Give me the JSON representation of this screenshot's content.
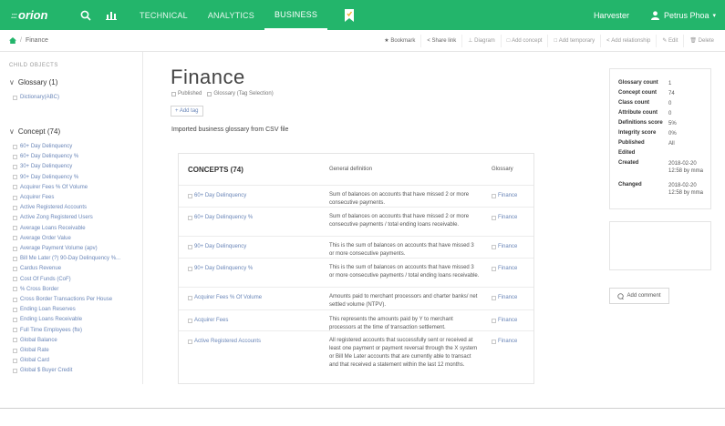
{
  "nav": {
    "logo": "orion",
    "links": [
      "TECHNICAL",
      "ANALYTICS",
      "BUSINESS"
    ],
    "active": "BUSINESS",
    "harvester": "Harvester",
    "user": "Petrus Phoa"
  },
  "toolbar": {
    "crumb": "Finance",
    "tools": [
      "Bookmark",
      "Share link",
      "Diagram",
      "Add concept",
      "Add temporary",
      "Add relationship",
      "Edit",
      "Delete"
    ]
  },
  "sidebar": {
    "head": "CHILD OBJECTS",
    "glossary_label": "Glossary (1)",
    "glossary_items": [
      "Dictionary(ABC)"
    ],
    "concept_label": "Concept (74)",
    "concept_items": [
      "60+ Day Delinquency",
      "60+ Day Delinquency %",
      "30+ Day Delinquency",
      "90+ Day Delinquency %",
      "Acquirer Fees % Of Volume",
      "Acquirer Fees",
      "Active Registered Accounts",
      "Active Zong Registered Users",
      "Average Loans Receivable",
      "Average Order Value",
      "Average Payment Volume (apv)",
      "Bill Me Later (?) 90-Day Delinquency %...",
      "Cardus Revenue",
      "Cost Of Funds (CoF)",
      "% Cross Border",
      "Cross Border Transactions Per House",
      "Ending Loan Reserves",
      "Ending Loans Receivable",
      "Full Time Employees (fte)",
      "Global Balance",
      "Global Rate",
      "Global Card",
      "Global $ Buyer Credit"
    ]
  },
  "main": {
    "title": "Finance",
    "published": "Published",
    "glossary_tag": "Glossary (Tag Selection)",
    "add_tag": "+ Add tag",
    "description": "Imported business glossary from CSV file"
  },
  "concepts": {
    "header": "CONCEPTS (74)",
    "col_def": "General definition",
    "col_gloss": "Glossary",
    "rows": [
      {
        "name": "60+ Day Delinquency",
        "def": "Sum of balances on accounts that have missed 2 or more consecutive payments.",
        "gloss": "Finance"
      },
      {
        "name": "60+ Day Delinquency %",
        "def": "Sum of balances on accounts that have missed 2 or more consecutive payments / total ending loans receivable.",
        "gloss": "Finance"
      },
      {
        "name": "90+ Day Delinquency",
        "def": "This is the sum of balances on accounts that have missed 3 or more consecutive payments.",
        "gloss": "Finance"
      },
      {
        "name": "90+ Day Delinquency %",
        "def": "This is the sum of balances on accounts that have missed 3 or more consecutive payments / total ending loans receivable.",
        "gloss": "Finance"
      },
      {
        "name": "Acquirer Fees % Of Volume",
        "def": "Amounts paid to merchant processors and charter banks/ net settled volume (NTPV).",
        "gloss": "Finance"
      },
      {
        "name": "Acquirer Fees",
        "def": "This represents the amounts paid by Y to merchant processors at the time of transaction settlement.",
        "gloss": "Finance"
      },
      {
        "name": "Active Registered Accounts",
        "def": "All registered accounts that successfully sent or received at least one payment or payment reversal through the X system or Bill Me Later accounts that are currently able to transact and that received a statement within the last 12 months.",
        "gloss": "Finance"
      }
    ]
  },
  "info": {
    "rows": [
      {
        "k": "Glossary count",
        "v": "1"
      },
      {
        "k": "Concept count",
        "v": "74"
      },
      {
        "k": "Class count",
        "v": "0"
      },
      {
        "k": "Attribute count",
        "v": "0"
      },
      {
        "k": "Definitions score",
        "v": "5%"
      },
      {
        "k": "Integrity score",
        "v": "0%"
      },
      {
        "k": "Published",
        "v": "All"
      },
      {
        "k": "Edited",
        "v": ""
      },
      {
        "k": "Created",
        "v": "2018-02-20 12:58 by mma"
      },
      {
        "k": "Changed",
        "v": "2018-02-20 12:58 by mma"
      }
    ],
    "add_comment": "Add comment"
  }
}
